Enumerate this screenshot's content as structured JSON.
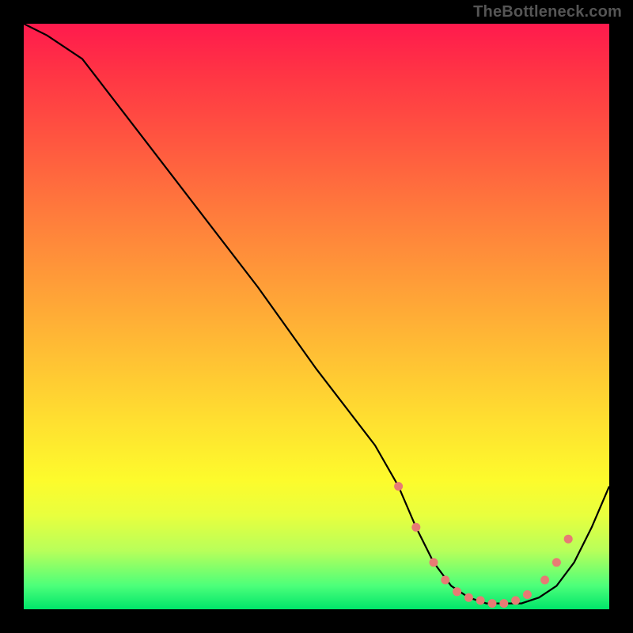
{
  "watermark": "TheBottleneck.com",
  "chart_data": {
    "type": "line",
    "title": "",
    "xlabel": "",
    "ylabel": "",
    "xlim": [
      0,
      100
    ],
    "ylim": [
      0,
      100
    ],
    "series": [
      {
        "name": "bottleneck-curve",
        "x": [
          0,
          4,
          10,
          20,
          30,
          40,
          50,
          60,
          64,
          67,
          70,
          73,
          76,
          79,
          82,
          85,
          88,
          91,
          94,
          97,
          100
        ],
        "y": [
          100,
          98,
          94,
          81,
          68,
          55,
          41,
          28,
          21,
          14,
          8,
          4,
          2,
          1,
          1,
          1,
          2,
          4,
          8,
          14,
          21
        ]
      }
    ],
    "markers": [
      {
        "x": 64,
        "y": 21
      },
      {
        "x": 67,
        "y": 14
      },
      {
        "x": 70,
        "y": 8
      },
      {
        "x": 72,
        "y": 5
      },
      {
        "x": 74,
        "y": 3
      },
      {
        "x": 76,
        "y": 2
      },
      {
        "x": 78,
        "y": 1.5
      },
      {
        "x": 80,
        "y": 1
      },
      {
        "x": 82,
        "y": 1
      },
      {
        "x": 84,
        "y": 1.5
      },
      {
        "x": 86,
        "y": 2.5
      },
      {
        "x": 89,
        "y": 5
      },
      {
        "x": 91,
        "y": 8
      },
      {
        "x": 93,
        "y": 12
      }
    ],
    "gradient_bands": [
      {
        "color": "#ff1a4d",
        "value": 100
      },
      {
        "color": "#ff7a3c",
        "value": 68
      },
      {
        "color": "#ffe030",
        "value": 32
      },
      {
        "color": "#fdfb2c",
        "value": 22
      },
      {
        "color": "#4cff7a",
        "value": 4
      },
      {
        "color": "#00e56a",
        "value": 0
      }
    ]
  }
}
